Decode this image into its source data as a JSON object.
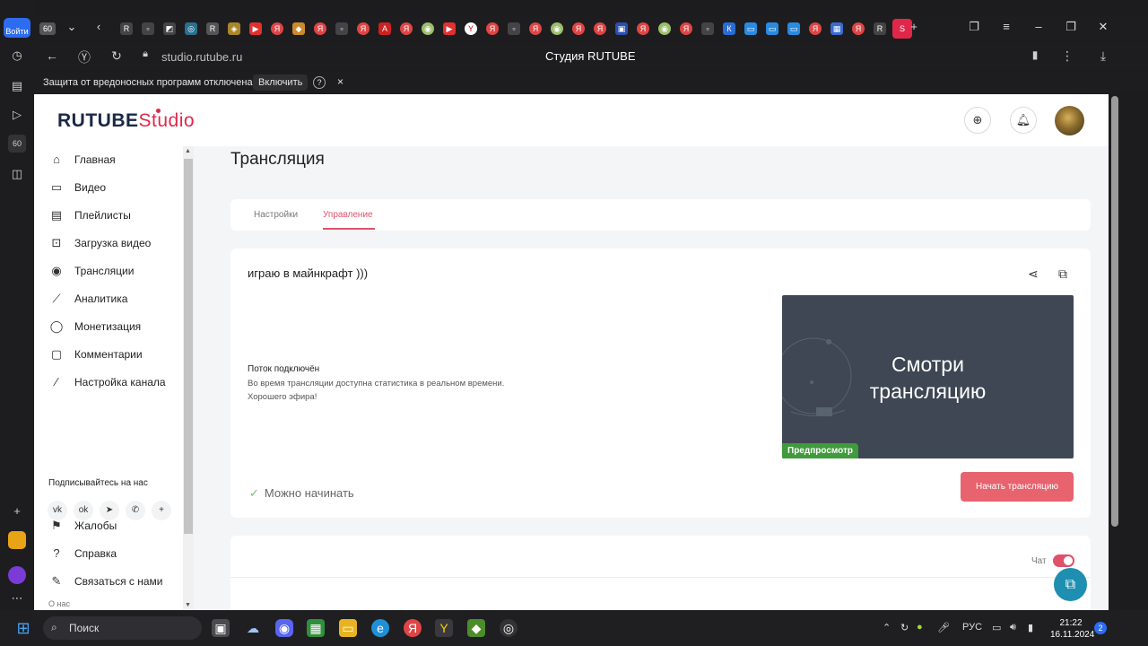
{
  "browser": {
    "login_label": "Войти",
    "url": "studio.rutube.ru",
    "title": "Студия RUTUBE",
    "notice": {
      "message": "Защита от вредоносных программ отключена",
      "enable_label": "Включить",
      "help": "?",
      "close": "×"
    }
  },
  "header": {
    "logo_main": "RUTUBE",
    "logo_studio": "Studio"
  },
  "sidebar": {
    "items": [
      {
        "label": "Главная",
        "icon": "home-icon"
      },
      {
        "label": "Видео",
        "icon": "video-icon"
      },
      {
        "label": "Плейлисты",
        "icon": "playlist-icon"
      },
      {
        "label": "Загрузка видео",
        "icon": "upload-icon"
      },
      {
        "label": "Трансляции",
        "icon": "broadcast-icon"
      },
      {
        "label": "Аналитика",
        "icon": "analytics-icon"
      },
      {
        "label": "Монетизация",
        "icon": "monetization-icon"
      },
      {
        "label": "Комментарии",
        "icon": "comments-icon"
      },
      {
        "label": "Настройка канала",
        "icon": "wand-icon"
      }
    ],
    "follow_label": "Подписывайтесь на нас",
    "socials": [
      "vk",
      "ok",
      "telegram",
      "viber",
      "more"
    ],
    "bottom_items": [
      {
        "label": "Жалобы",
        "icon": "flag-icon"
      },
      {
        "label": "Справка",
        "icon": "help-icon"
      },
      {
        "label": "Связаться с нами",
        "icon": "edit-icon"
      }
    ],
    "about_label": "О нас"
  },
  "main": {
    "title": "Трансляция",
    "tabs": [
      {
        "label": "Настройки",
        "active": false
      },
      {
        "label": "Управление",
        "active": true
      }
    ],
    "stream": {
      "title": "играю в майнкрафт )))",
      "status_head": "Поток подключён",
      "status_line1": "Во время трансляции доступна статистика в реальном времени.",
      "status_line2": "Хорошего эфира!",
      "preview_line1": "Смотри",
      "preview_line2": "трансляцию",
      "preview_badge": "Предпросмотр",
      "ready_label": "Можно начинать",
      "start_label": "Начать трансляцию"
    },
    "chat_label": "Чат"
  },
  "taskbar": {
    "search_label": "Поиск",
    "lang": "РУС",
    "time": "21:22",
    "date": "16.11.2024"
  },
  "colors": {
    "accent": "#e0506a",
    "start_button": "#e7636e",
    "preview_bg": "#3e4753",
    "badge_green": "#3f9b3c",
    "support_blue": "#1e8fb0"
  }
}
